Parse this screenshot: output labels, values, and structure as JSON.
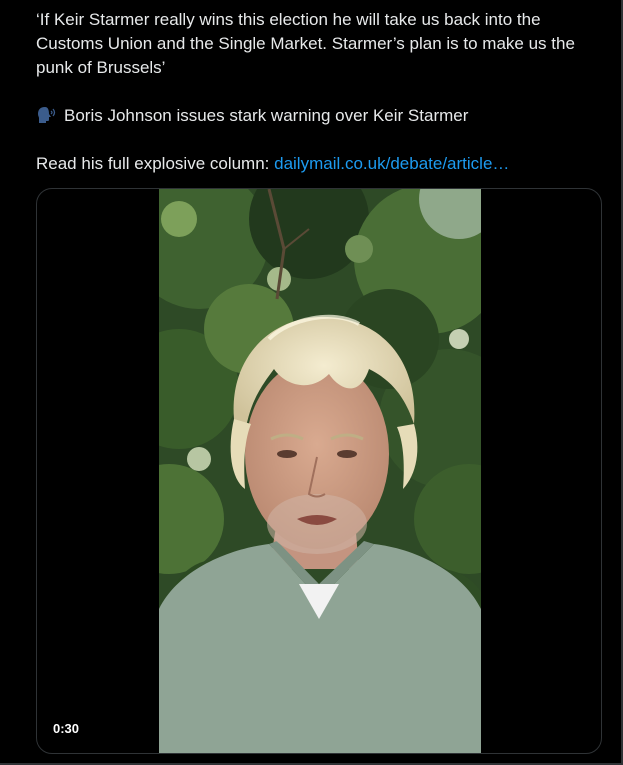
{
  "tweet": {
    "quote_line_1": "‘If Keir Starmer really wins this election he will take us back into the",
    "quote_line_2": "Customs Union and the Single Market. Starmer’s plan is to make us the",
    "quote_line_3": "punk of Brussels’",
    "headline": "Boris Johnson issues stark warning over Keir Starmer",
    "headline_icon": "speaking-head-icon",
    "read_more_prefix": "Read his full explosive column: ",
    "link_text": "dailymail.co.uk/debate/article…"
  },
  "media": {
    "type": "video",
    "duration": "0:30",
    "thumbnail_icon": "video-thumbnail"
  },
  "colors": {
    "background": "#000000",
    "text": "#e7e9ea",
    "link": "#1d9bf0",
    "border": "#2f3336"
  }
}
